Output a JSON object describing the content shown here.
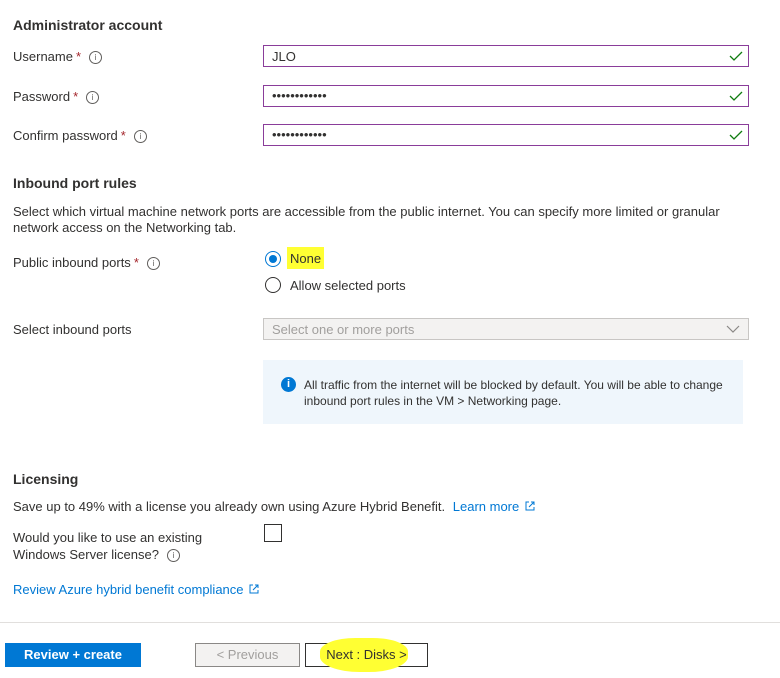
{
  "admin": {
    "title": "Administrator account",
    "username_label": "Username",
    "username_value": "JLO",
    "password_label": "Password",
    "password_value": "••••••••••••",
    "confirm_label": "Confirm password",
    "confirm_value": "••••••••••••",
    "required_mark": "*"
  },
  "inbound": {
    "title": "Inbound port rules",
    "description": "Select which virtual machine network ports are accessible from the public internet. You can specify more limited or granular network access on the Networking tab.",
    "public_label": "Public inbound ports",
    "option_none": "None",
    "option_allow": "Allow selected ports",
    "select_label": "Select inbound ports",
    "select_placeholder": "Select one or more ports",
    "info_text": "All traffic from the internet will be blocked by default. You will be able to change inbound port rules in the VM > Networking page."
  },
  "licensing": {
    "title": "Licensing",
    "description": "Save up to 49% with a license you already own using Azure Hybrid Benefit.",
    "learn_more": "Learn more",
    "question_line1": "Would you like to use an existing",
    "question_line2": "Windows Server license?",
    "review_link": "Review Azure hybrid benefit compliance"
  },
  "footer": {
    "review_create": "Review + create",
    "previous": "< Previous",
    "next": "Next : Disks >"
  },
  "colors": {
    "accent": "#0078d4",
    "valid_check": "#107c10",
    "field_border": "#8a3d9a",
    "highlight": "#ffff33"
  }
}
